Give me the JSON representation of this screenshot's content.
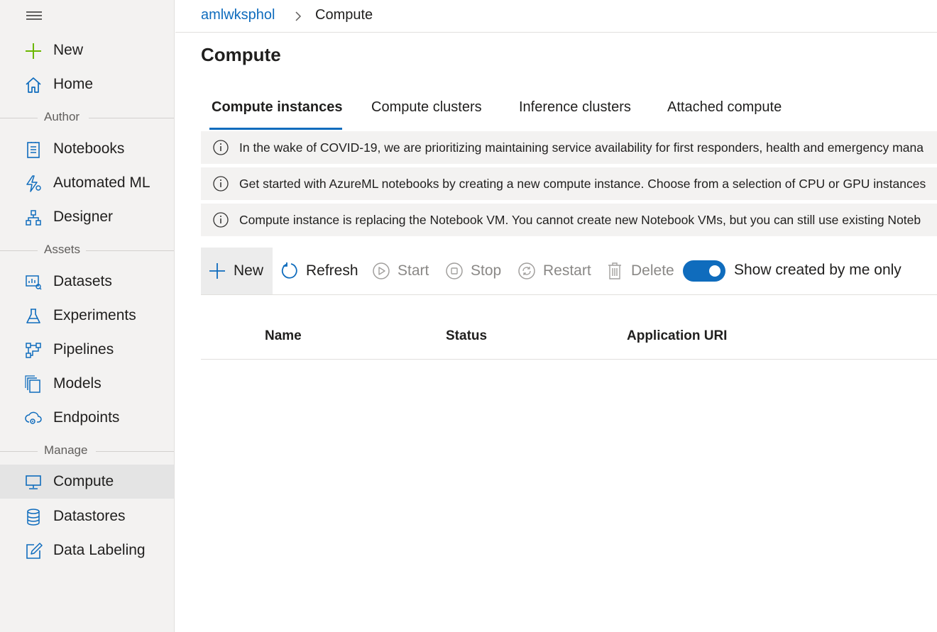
{
  "sidebar": {
    "top_items": [
      {
        "label": "New",
        "icon": "plus-icon"
      },
      {
        "label": "Home",
        "icon": "home-icon"
      }
    ],
    "sections": [
      {
        "title": "Author",
        "items": [
          {
            "label": "Notebooks",
            "icon": "notebook-icon"
          },
          {
            "label": "Automated ML",
            "icon": "automated-ml-icon"
          },
          {
            "label": "Designer",
            "icon": "designer-icon"
          }
        ]
      },
      {
        "title": "Assets",
        "items": [
          {
            "label": "Datasets",
            "icon": "datasets-icon"
          },
          {
            "label": "Experiments",
            "icon": "flask-icon"
          },
          {
            "label": "Pipelines",
            "icon": "pipeline-icon"
          },
          {
            "label": "Models",
            "icon": "models-icon"
          },
          {
            "label": "Endpoints",
            "icon": "endpoint-icon"
          }
        ]
      },
      {
        "title": "Manage",
        "items": [
          {
            "label": "Compute",
            "icon": "monitor-icon",
            "active": true
          },
          {
            "label": "Datastores",
            "icon": "database-icon"
          },
          {
            "label": "Data Labeling",
            "icon": "edit-icon"
          }
        ]
      }
    ]
  },
  "breadcrumb": {
    "workspace": "amlwksphol",
    "current": "Compute"
  },
  "page": {
    "title": "Compute"
  },
  "tabs": [
    {
      "label": "Compute instances",
      "active": true
    },
    {
      "label": "Compute clusters"
    },
    {
      "label": "Inference clusters"
    },
    {
      "label": "Attached compute"
    }
  ],
  "banners": [
    "In the wake of COVID-19, we are prioritizing maintaining service availability for first responders, health and emergency mana",
    "Get started with AzureML notebooks by creating a new compute instance. Choose from a selection of CPU or GPU instances",
    "Compute instance is replacing the Notebook VM. You cannot create new Notebook VMs, but you can still use existing Noteb"
  ],
  "toolbar": {
    "new": "New",
    "refresh": "Refresh",
    "start": "Start",
    "stop": "Stop",
    "restart": "Restart",
    "delete": "Delete",
    "toggle_label": "Show created by me only",
    "toggle_on": true
  },
  "table": {
    "columns": [
      "Name",
      "Status",
      "Application URI"
    ]
  },
  "colors": {
    "accent": "#0f6cbd",
    "new_icon": "#6bb700"
  }
}
